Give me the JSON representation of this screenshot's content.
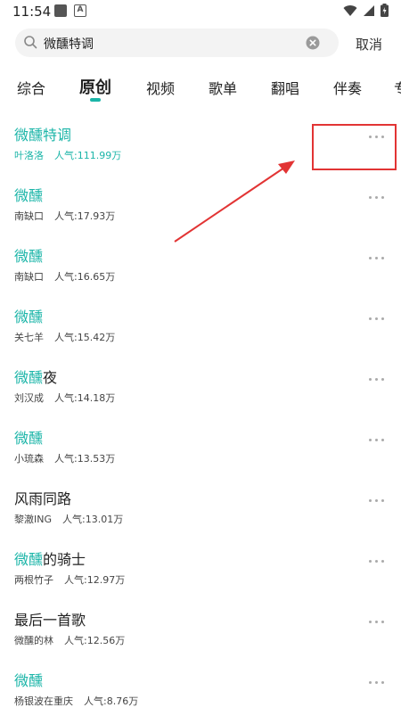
{
  "status": {
    "time": "11:54",
    "ic_b": "A"
  },
  "search": {
    "query": "微醺特调",
    "placeholder": "",
    "cancel_label": "取消"
  },
  "tabs": [
    {
      "label": "综合"
    },
    {
      "label": "原创"
    },
    {
      "label": "视频"
    },
    {
      "label": "歌单"
    },
    {
      "label": "翻唱"
    },
    {
      "label": "伴奏"
    },
    {
      "label": "专"
    }
  ],
  "results": [
    {
      "title_hl": "微醺特调",
      "title_rest": "",
      "artist": "叶洛洛",
      "popularity": "人气:111.99万"
    },
    {
      "title_hl": "微醺",
      "title_rest": "",
      "artist": "南缺口",
      "popularity": "人气:17.93万"
    },
    {
      "title_hl": "微醺",
      "title_rest": "",
      "artist": "南缺口",
      "popularity": "人气:16.65万"
    },
    {
      "title_hl": "微醺",
      "title_rest": "",
      "artist": "关七羊",
      "popularity": "人气:15.42万"
    },
    {
      "title_hl": "微醺",
      "title_rest": "夜",
      "artist": "刘汉成",
      "popularity": "人气:14.18万"
    },
    {
      "title_hl": "微醺",
      "title_rest": "",
      "artist": "小琉森",
      "popularity": "人气:13.53万"
    },
    {
      "title_hl": "",
      "title_rest": "风雨同路",
      "artist": "黎澈ING",
      "popularity": "人气:13.01万"
    },
    {
      "title_hl": "微醺",
      "title_rest": "的骑士",
      "artist": "两根竹子",
      "popularity": "人气:12.97万"
    },
    {
      "title_hl": "",
      "title_rest": "最后一首歌",
      "artist": "微醺的林",
      "popularity": "人气:12.56万"
    },
    {
      "title_hl": "微醺",
      "title_rest": "",
      "artist": "杨银波在重庆",
      "popularity": "人气:8.76万"
    }
  ],
  "colors": {
    "accent": "#1bb5a8",
    "annotation": "#e23434"
  }
}
